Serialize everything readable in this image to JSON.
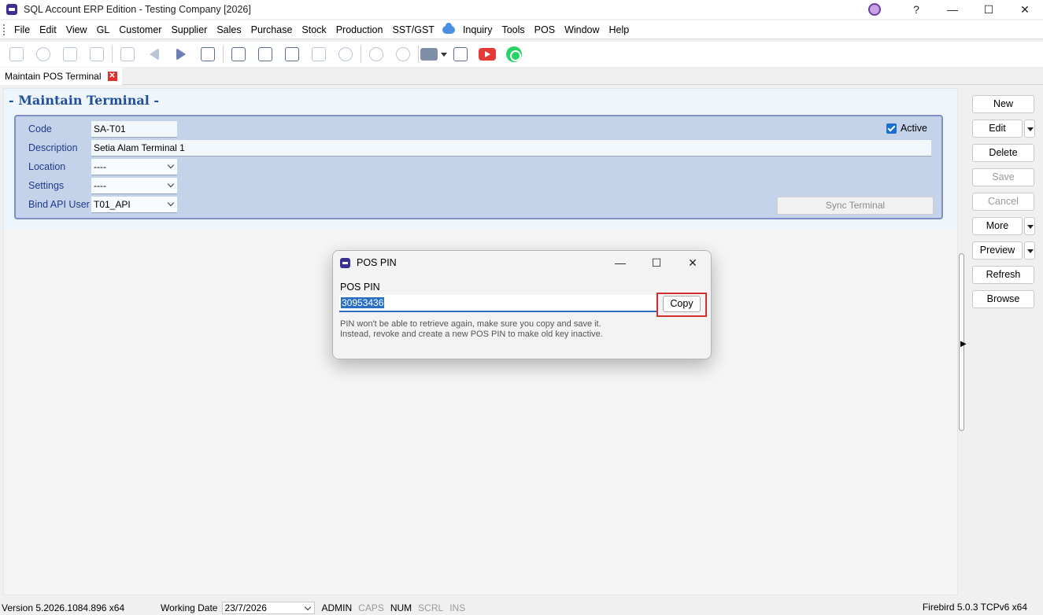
{
  "window": {
    "title": "SQL Account ERP Edition - Testing Company [2026]",
    "help_label": "?",
    "minimize": "—",
    "maximize": "☐",
    "close": "✕"
  },
  "menu": [
    "File",
    "Edit",
    "View",
    "GL",
    "Customer",
    "Supplier",
    "Sales",
    "Purchase",
    "Stock",
    "Production",
    "SST/GST",
    "Inquiry",
    "Tools",
    "POS",
    "Window",
    "Help"
  ],
  "doc_tab": {
    "label": "Maintain POS Terminal",
    "close": "✕"
  },
  "page": {
    "title": "- Maintain Terminal -"
  },
  "form": {
    "code_label": "Code",
    "code_value": "SA-T01",
    "description_label": "Description",
    "description_value": "Setia Alam Terminal 1",
    "location_label": "Location",
    "location_value": "----",
    "settings_label": "Settings",
    "settings_value": "----",
    "bind_label": "Bind API User",
    "bind_value": "T01_API",
    "active_label": "Active",
    "sync_label": "Sync Terminal"
  },
  "sidebar": {
    "new": "New",
    "edit": "Edit",
    "delete": "Delete",
    "save": "Save",
    "cancel": "Cancel",
    "more": "More",
    "preview": "Preview",
    "refresh": "Refresh",
    "browse": "Browse"
  },
  "dialog": {
    "title": "POS PIN",
    "pin_label": "POS PIN",
    "pin_value": "30953436",
    "copy_label": "Copy",
    "note_line1": "PIN won't be able to retrieve again, make sure you copy and save it.",
    "note_line2": "Instead, revoke and create a new POS PIN to make old key inactive.",
    "minimize": "—",
    "maximize": "☐",
    "close": "✕"
  },
  "statusbar": {
    "version": "Version 5.2026.1084.896 x64",
    "working_date_label": "Working Date",
    "working_date": "23/7/2026",
    "user": "ADMIN",
    "caps": "CAPS",
    "num": "NUM",
    "scrl": "SCRL",
    "ins": "INS",
    "db": "Firebird 5.0.3 TCPv6 x64"
  },
  "colors": {
    "accent": "#1f4f9e",
    "panel": "#c5d3ea",
    "highlight": "#d32f2f"
  }
}
